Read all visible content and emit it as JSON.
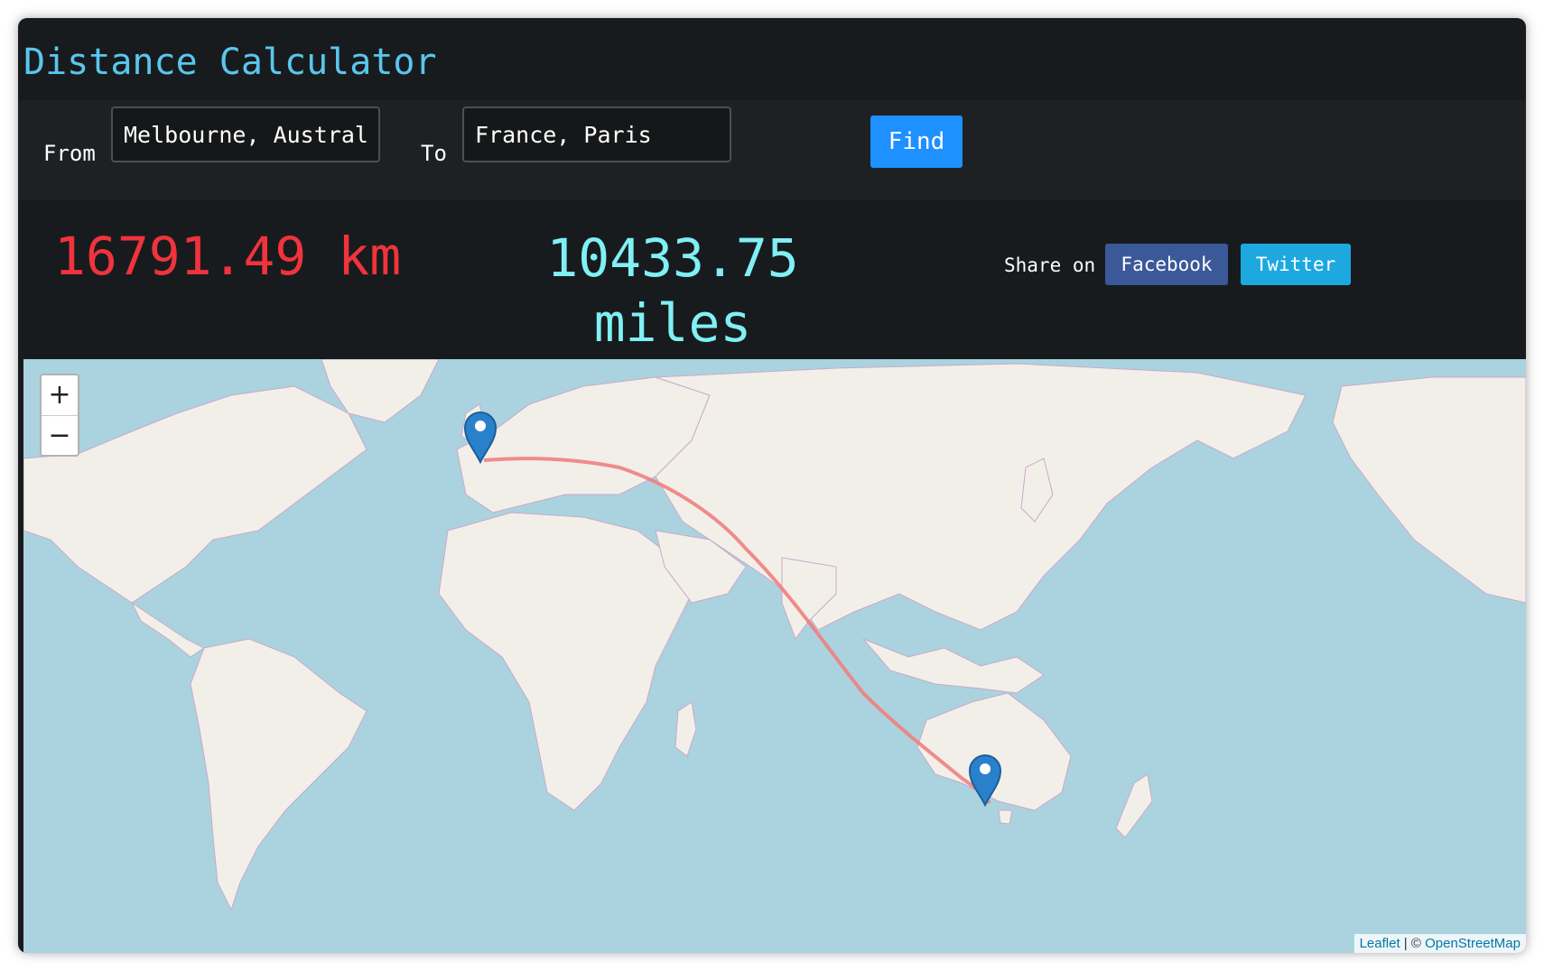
{
  "app": {
    "title": "Distance Calculator"
  },
  "form": {
    "from_label": "From",
    "from_value": "Melbourne, Australia",
    "to_label": "To",
    "to_value": "France, Paris",
    "find_label": "Find"
  },
  "result": {
    "km": "16791.49 km",
    "miles": "10433.75 miles"
  },
  "share": {
    "label": "Share on",
    "facebook": "Facebook",
    "twitter": "Twitter"
  },
  "map": {
    "zoom_in": "+",
    "zoom_out": "−",
    "attribution_leaflet": "Leaflet",
    "attribution_sep": " | © ",
    "attribution_osm": "OpenStreetMap",
    "route_color": "#f08080",
    "marker_color": "#2a81cb",
    "markers": [
      "paris-marker",
      "melbourne-marker"
    ]
  },
  "colors": {
    "title": "#59c6ee",
    "km": "#f0333c",
    "miles": "#7ff0f6",
    "find": "#1e90ff",
    "facebook": "#3b5999",
    "twitter": "#1da9e0"
  }
}
